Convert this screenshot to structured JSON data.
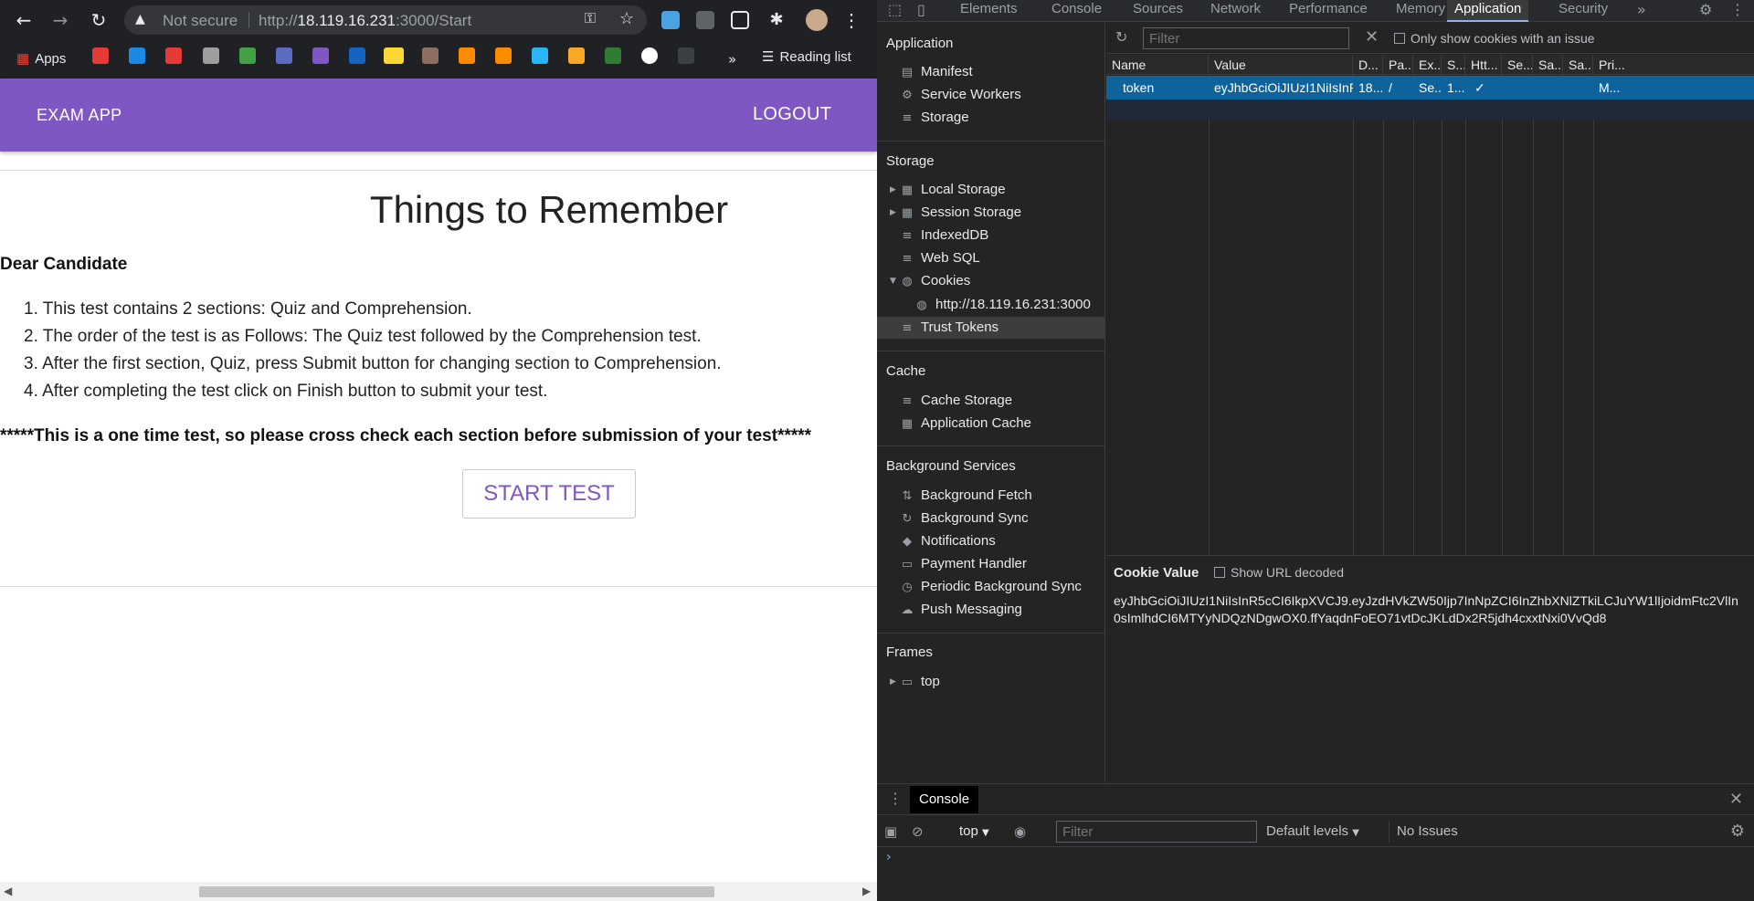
{
  "browser": {
    "security_label": "Not secure",
    "url_prefix": "http://",
    "url_host": "18.119.16.231",
    "url_path": ":3000/Start",
    "bookmarks": {
      "apps_label": "Apps",
      "reading_list": "Reading list"
    }
  },
  "page": {
    "app_title": "EXAM APP",
    "logout_label": "LOGOUT",
    "title": "Things to Remember",
    "greeting": "Dear Candidate",
    "rules": [
      "1. This test contains 2 sections: Quiz and Comprehension.",
      "2. The order of the test is as Follows: The Quiz test followed by the Comprehension test.",
      "3. After the first section, Quiz, press Submit button for changing section to Comprehension.",
      "4. After completing the test click on Finish button to submit your test."
    ],
    "warning": "*****This is a one time test, so please cross check each section before submission of your test*****",
    "start_button": "START TEST",
    "colors": {
      "header": "#7e57c2",
      "accent": "#7e57c2"
    }
  },
  "devtools": {
    "tabs": [
      "Elements",
      "Console",
      "Sources",
      "Network",
      "Performance",
      "Memory",
      "Application",
      "Security"
    ],
    "more_tabs": "»",
    "active_tab": "Application",
    "sidebar": {
      "application_header": "Application",
      "application_items": [
        "Manifest",
        "Service Workers",
        "Storage"
      ],
      "storage_header": "Storage",
      "storage_items": [
        "Local Storage",
        "Session Storage",
        "IndexedDB",
        "Web SQL",
        "Cookies",
        "http://18.119.16.231:3000",
        "Trust Tokens"
      ],
      "cache_header": "Cache",
      "cache_items": [
        "Cache Storage",
        "Application Cache"
      ],
      "bg_header": "Background Services",
      "bg_items": [
        "Background Fetch",
        "Background Sync",
        "Notifications",
        "Payment Handler",
        "Periodic Background Sync",
        "Push Messaging"
      ],
      "frames_header": "Frames",
      "frames_items": [
        "top"
      ]
    },
    "cookies": {
      "filter_placeholder": "Filter",
      "only_issues_label": "Only show cookies with an issue",
      "columns": [
        "Name",
        "Value",
        "D...",
        "Pa...",
        "Ex...",
        "S...",
        "Htt...",
        "Se...",
        "Sa...",
        "Sa...",
        "Pri..."
      ],
      "rows": [
        [
          "token",
          "eyJhbGciOiJIUzI1NiIsInR5...",
          "18...",
          "/",
          "Se...",
          "1...",
          "✓",
          "",
          "",
          "",
          "M..."
        ]
      ],
      "value_label": "Cookie Value",
      "show_url_decoded": "Show URL decoded",
      "value": "eyJhbGciOiJIUzI1NiIsInR5cCI6IkpXVCJ9.eyJzdHVkZW50Ijp7InNpZCI6InZhbXNlZTkiLCJuYW1lIjoidmFtc2VlIn0sImlhdCI6MTYyNDQzNDgwOX0.ffYaqdnFoEO71vtDcJKLdDx2R5jdh4cxxtNxi0VvQd8"
    },
    "drawer": {
      "tab": "Console",
      "context": "top",
      "filter_placeholder": "Filter",
      "levels": "Default levels",
      "issues": "No Issues",
      "prompt": "›"
    }
  }
}
